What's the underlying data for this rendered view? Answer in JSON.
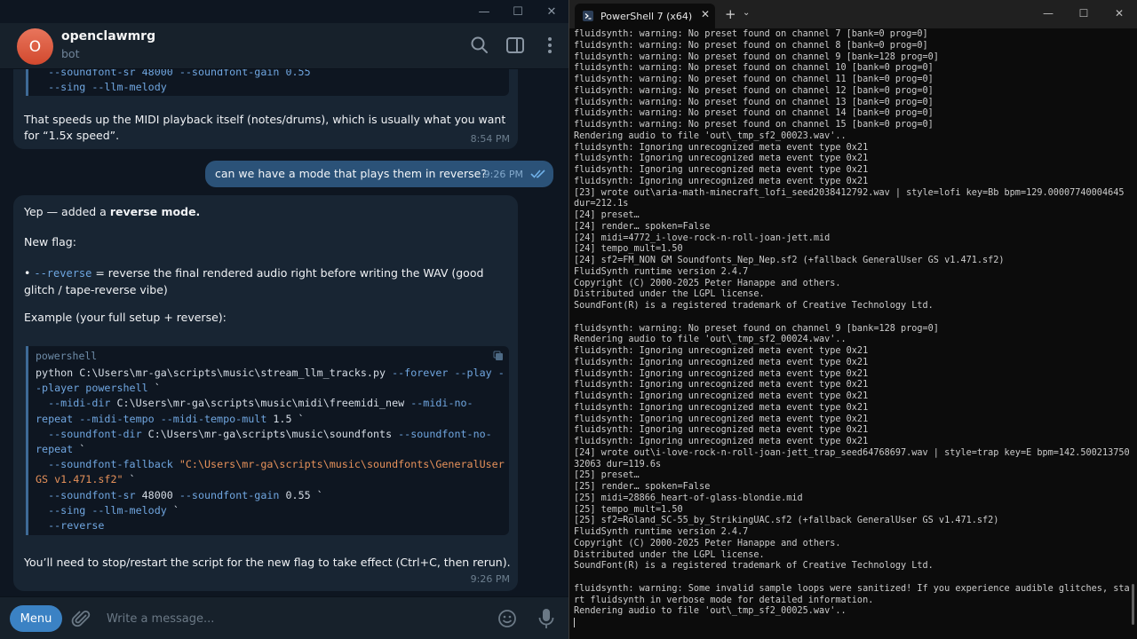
{
  "telegram": {
    "window_controls": [
      "—",
      "☐",
      "✕"
    ],
    "header": {
      "avatar_letter": "O",
      "name": "openclawmrg",
      "subtitle": "bot"
    },
    "messages": {
      "m1": {
        "code_tail": [
          "  --soundfont-sr 48000 --soundfont-gain 0.55",
          "  --sing --llm-melody"
        ],
        "text": "That speeds up the MIDI playback itself (notes/drums), which is usually what you want for “1.5x speed”.",
        "time": "8:54 PM"
      },
      "m2": {
        "text": "can we have a mode that plays them in reverse?",
        "time": "9:26 PM"
      },
      "m3": {
        "intro_prefix": "Yep — added a ",
        "intro_bold": "reverse mode.",
        "flag_title": "New flag:",
        "flag_bullet": "• ",
        "flag_name": "--reverse",
        "flag_desc": " = reverse the final rendered audio right before writing the WAV (good glitch / tape-reverse vibe)",
        "example_title": "Example (your full setup + reverse):",
        "code_lang": "powershell",
        "code": {
          "l1a": "python C:\\Users\\mr-ga\\scripts\\music\\stream_llm_tracks.py ",
          "l1b": "--forever --play --player powershell",
          "l1c": " `",
          "l2a": "  --midi-dir",
          "l2b": " C:\\Users\\mr-ga\\scripts\\music\\midi\\freemidi_new ",
          "l2c": "--midi-no-repeat --midi-tempo --midi-tempo-mult",
          "l2d": " 1.5 `",
          "l3a": "  --soundfont-dir",
          "l3b": " C:\\Users\\mr-ga\\scripts\\music\\soundfonts ",
          "l3c": "--soundfont-no-repeat",
          "l3d": " `",
          "l4a": "  --soundfont-fallback",
          "l4b": " \"C:\\Users\\mr-ga\\scripts\\music\\soundfonts\\GeneralUser GS v1.471.sf2\"",
          "l4c": " `",
          "l5a": "  --soundfont-sr",
          "l5b": " 48000 ",
          "l5c": "--soundfont-gain",
          "l5d": " 0.55 `",
          "l6a": "  --sing --llm-melody",
          "l6b": " `",
          "l7a": "  --reverse"
        },
        "note": "You’ll need to stop/restart the script for the new flag to take effect (Ctrl+C, then rerun).",
        "time": "9:26 PM"
      }
    },
    "composer": {
      "menu_label": "Menu",
      "placeholder": "Write a message..."
    }
  },
  "powershell": {
    "tab_title": "PowerShell 7 (x64)",
    "tab_close": "✕",
    "new_tab": "+",
    "dropdown": "⌄",
    "window_controls": [
      "—",
      "☐",
      "✕"
    ],
    "lines": [
      "fluidsynth: warning: No preset found on channel 7 [bank=0 prog=0]",
      "fluidsynth: warning: No preset found on channel 8 [bank=0 prog=0]",
      "fluidsynth: warning: No preset found on channel 9 [bank=128 prog=0]",
      "fluidsynth: warning: No preset found on channel 10 [bank=0 prog=0]",
      "fluidsynth: warning: No preset found on channel 11 [bank=0 prog=0]",
      "fluidsynth: warning: No preset found on channel 12 [bank=0 prog=0]",
      "fluidsynth: warning: No preset found on channel 13 [bank=0 prog=0]",
      "fluidsynth: warning: No preset found on channel 14 [bank=0 prog=0]",
      "fluidsynth: warning: No preset found on channel 15 [bank=0 prog=0]",
      "Rendering audio to file 'out\\_tmp_sf2_00023.wav'..",
      "fluidsynth: Ignoring unrecognized meta event type 0x21",
      "fluidsynth: Ignoring unrecognized meta event type 0x21",
      "fluidsynth: Ignoring unrecognized meta event type 0x21",
      "fluidsynth: Ignoring unrecognized meta event type 0x21",
      "[23] wrote out\\aria-math-minecraft_lofi_seed2038412792.wav | style=lofi key=Bb bpm=129.00007740004645",
      "dur=212.1s",
      "[24] preset…",
      "[24] render… spoken=False",
      "[24] midi=4772_i-love-rock-n-roll-joan-jett.mid",
      "[24] tempo_mult=1.50",
      "[24] sf2=FM_NON GM Soundfonts_Nep_Nep.sf2 (+fallback GeneralUser GS v1.471.sf2)",
      "FluidSynth runtime version 2.4.7",
      "Copyright (C) 2000-2025 Peter Hanappe and others.",
      "Distributed under the LGPL license.",
      "SoundFont(R) is a registered trademark of Creative Technology Ltd.",
      "",
      "fluidsynth: warning: No preset found on channel 9 [bank=128 prog=0]",
      "Rendering audio to file 'out\\_tmp_sf2_00024.wav'..",
      "fluidsynth: Ignoring unrecognized meta event type 0x21",
      "fluidsynth: Ignoring unrecognized meta event type 0x21",
      "fluidsynth: Ignoring unrecognized meta event type 0x21",
      "fluidsynth: Ignoring unrecognized meta event type 0x21",
      "fluidsynth: Ignoring unrecognized meta event type 0x21",
      "fluidsynth: Ignoring unrecognized meta event type 0x21",
      "fluidsynth: Ignoring unrecognized meta event type 0x21",
      "fluidsynth: Ignoring unrecognized meta event type 0x21",
      "fluidsynth: Ignoring unrecognized meta event type 0x21",
      "[24] wrote out\\i-love-rock-n-roll-joan-jett_trap_seed64768697.wav | style=trap key=E bpm=142.500213750",
      "32063 dur=119.6s",
      "[25] preset…",
      "[25] render… spoken=False",
      "[25] midi=28866_heart-of-glass-blondie.mid",
      "[25] tempo_mult=1.50",
      "[25] sf2=Roland_SC-55_by_StrikingUAC.sf2 (+fallback GeneralUser GS v1.471.sf2)",
      "FluidSynth runtime version 2.4.7",
      "Copyright (C) 2000-2025 Peter Hanappe and others.",
      "Distributed under the LGPL license.",
      "SoundFont(R) is a registered trademark of Creative Technology Ltd.",
      "",
      "fluidsynth: warning: Some invalid sample loops were sanitized! If you experience audible glitches, sta",
      "rt fluidsynth in verbose mode for detailed information.",
      "Rendering audio to file 'out\\_tmp_sf2_00025.wav'.."
    ]
  }
}
